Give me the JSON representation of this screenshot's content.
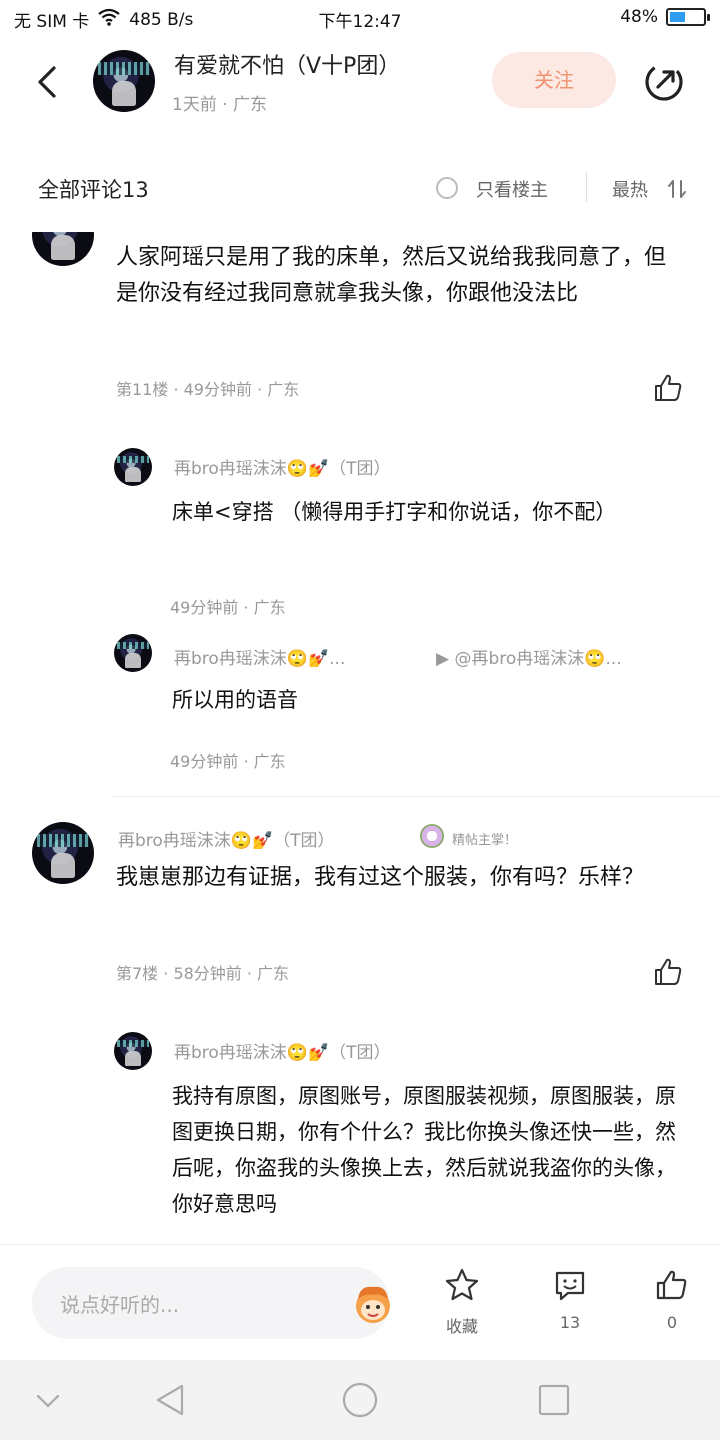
{
  "status_bar": {
    "carrier": "无 SIM 卡",
    "speed": "485 B/s",
    "time": "下午12:47",
    "battery": "48%",
    "battery_level": 0.48
  },
  "header": {
    "title": "有爱就不怕（V十P团）",
    "subtitle": "1天前 · 广东",
    "follow_label": "关注"
  },
  "filter": {
    "all_comments": "全部评论13",
    "only_op": "只看楼主",
    "sort": "最热"
  },
  "comments": [
    {
      "text": "人家阿瑶只是用了我的床单，然后又说给我我同意了，但是你没有经过我同意就拿我头像，你跟他没法比",
      "meta": "第11楼 · 49分钟前 · 广东",
      "replies": [
        {
          "name": "再bro冉瑶沫沫🙄💅（T团）",
          "text": "床单<穿搭 （懒得用手打字和你说话，你不配）",
          "meta": "49分钟前 · 广东"
        },
        {
          "name": "再bro冉瑶沫沫🙄💅...",
          "reply_to": "▶ @再bro冉瑶沫沫🙄...",
          "text": "所以用的语音",
          "meta": "49分钟前 · 广东"
        }
      ]
    },
    {
      "name": "再bro冉瑶沫沫🙄💅（T团）",
      "badge": "精帖主掌！",
      "text": "我崽崽那边有证据，我有过这个服装，你有吗？乐样？",
      "meta": "第7楼 · 58分钟前 · 广东",
      "replies": [
        {
          "name": "再bro冉瑶沫沫🙄💅（T团）",
          "text": "我持有原图，原图账号，原图服装视频，原图服装，原图更换日期，你有个什么？我比你换头像还快一些，然后呢，你盗我的头像换上去，然后就说我盗你的头像，你好意思吗"
        }
      ]
    }
  ],
  "bottom_bar": {
    "input_placeholder": "说点好听的...",
    "favorite_label": "收藏",
    "comment_count": "13",
    "like_count": "0"
  }
}
